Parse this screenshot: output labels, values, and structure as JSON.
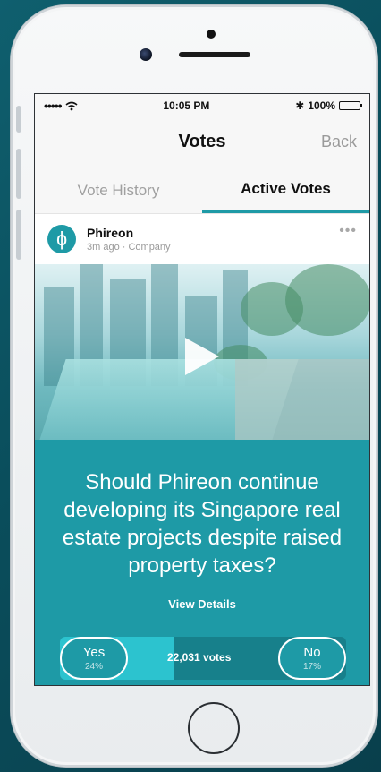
{
  "status_bar": {
    "signal": "•••••",
    "wifi_icon": "wifi-icon",
    "time": "10:05 PM",
    "bluetooth": "✱",
    "battery": "100%"
  },
  "nav": {
    "title": "Votes",
    "back_label": "Back"
  },
  "tabs": [
    {
      "label": "Vote History",
      "active": false
    },
    {
      "label": "Active Votes",
      "active": true
    }
  ],
  "post": {
    "avatar_glyph": "ɸ",
    "author": "Phireon",
    "meta": "3m ago · Company",
    "more": "•••"
  },
  "vote": {
    "question": "Should Phireon continue developing its Singapore real estate projects despite raised property taxes?",
    "view_details": "View Details",
    "yes_label": "Yes",
    "yes_pct": "24%",
    "no_label": "No",
    "no_pct": "17%",
    "votes_text": "22,031 votes",
    "yes_share": 0.4
  },
  "colors": {
    "accent": "#1e9aa6",
    "accent_dark": "#17808b",
    "accent_light": "#2cc3cf"
  }
}
